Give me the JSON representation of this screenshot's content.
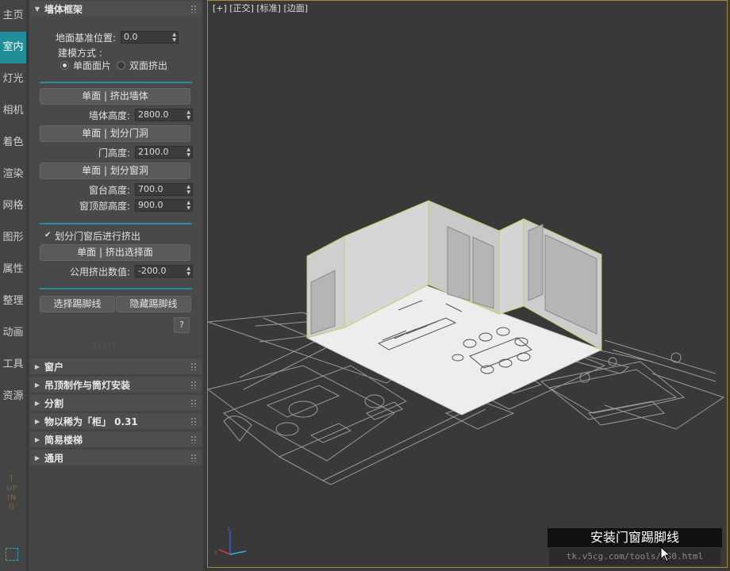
{
  "nav": {
    "items": [
      "主页",
      "室内",
      "灯光",
      "相机",
      "着色",
      "渲染",
      "网格",
      "图形",
      "属性",
      "整理",
      "动画",
      "工具",
      "资源"
    ],
    "active_index": 1,
    "brand": "TUPING"
  },
  "panel": {
    "wall_frame": {
      "title": "墙体框架",
      "floor_ref_label": "地面基准位置:",
      "floor_ref_value": "0.0",
      "build_mode_label": "建模方式 :",
      "option_single": "单面面片",
      "option_double": "双面挤出",
      "selected_option": "单面面片",
      "btn_extrude_wall": "单面 | 挤出墙体",
      "wall_height_label": "墙体高度:",
      "wall_height_value": "2800.0",
      "btn_split_door": "单面 | 划分门洞",
      "door_height_label": "门高度:",
      "door_height_value": "2100.0",
      "btn_split_window": "单面 | 划分窗洞",
      "sill_height_label": "窗台高度:",
      "sill_height_value": "700.0",
      "window_top_label": "窗顶部高度:",
      "window_top_value": "900.0",
      "checkbox_label": "划分门窗后进行挤出",
      "checkbox_checked": true,
      "btn_extrude_face": "单面 | 挤出选择面",
      "common_extrude_label": "公用挤出数值:",
      "common_extrude_value": "-200.0",
      "btn_select_baseboard": "选择踢脚线",
      "btn_hide_baseboard": "隐藏踢脚线",
      "help_label": "?"
    },
    "rollouts": [
      "窗户",
      "吊顶制作与筒灯安装",
      "分割",
      "物以稀为「柜」 0.31",
      "简易楼梯",
      "通用"
    ]
  },
  "viewport": {
    "label": "[+] [正交] [标准] [边面]",
    "caption": "安装门窗踢脚线",
    "url": "tk.v5cg.com/tools/t30.html",
    "accent_color": "#a68a3a",
    "wall_edge_color": "#b7d36a"
  }
}
